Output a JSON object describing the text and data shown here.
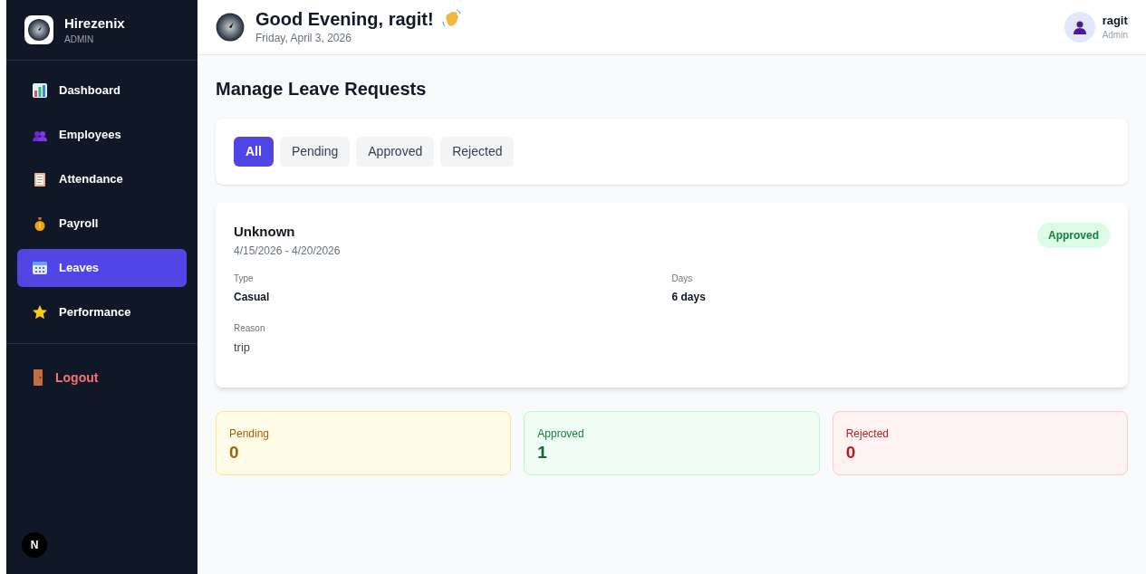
{
  "brand": {
    "name": "Hirezenix",
    "role": "ADMIN"
  },
  "nav": [
    {
      "label": "Dashboard",
      "kind": "chart",
      "selected": false
    },
    {
      "label": "Employees",
      "kind": "people",
      "selected": false
    },
    {
      "label": "Attendance",
      "kind": "clipboard",
      "selected": false
    },
    {
      "label": "Payroll",
      "kind": "money",
      "selected": false
    },
    {
      "label": "Leaves",
      "kind": "calendar",
      "selected": true
    },
    {
      "label": "Performance",
      "kind": "star",
      "selected": false
    }
  ],
  "logout": "Logout",
  "dev_badge": "N",
  "header": {
    "greeting": "Good Evening, ragit!",
    "date": "Friday, April 3, 2026",
    "user": "ragit",
    "user_role": "Admin"
  },
  "page_title": "Manage Leave Requests",
  "filters": [
    {
      "label": "All",
      "selected": true
    },
    {
      "label": "Pending",
      "selected": false
    },
    {
      "label": "Approved",
      "selected": false
    },
    {
      "label": "Rejected",
      "selected": false
    }
  ],
  "requests": [
    {
      "name": "Unknown",
      "dates": "4/15/2026 - 4/20/2026",
      "status": "Approved",
      "kind": "approved",
      "type_label": "Type",
      "type": "Casual",
      "days_label": "Days",
      "days": "6 days",
      "reason_label": "Reason",
      "reason": "trip"
    }
  ],
  "stats": [
    {
      "label": "Pending",
      "value": "0",
      "kind": "pending"
    },
    {
      "label": "Approved",
      "value": "1",
      "kind": "approved"
    },
    {
      "label": "Rejected",
      "value": "0",
      "kind": "rejected"
    }
  ]
}
